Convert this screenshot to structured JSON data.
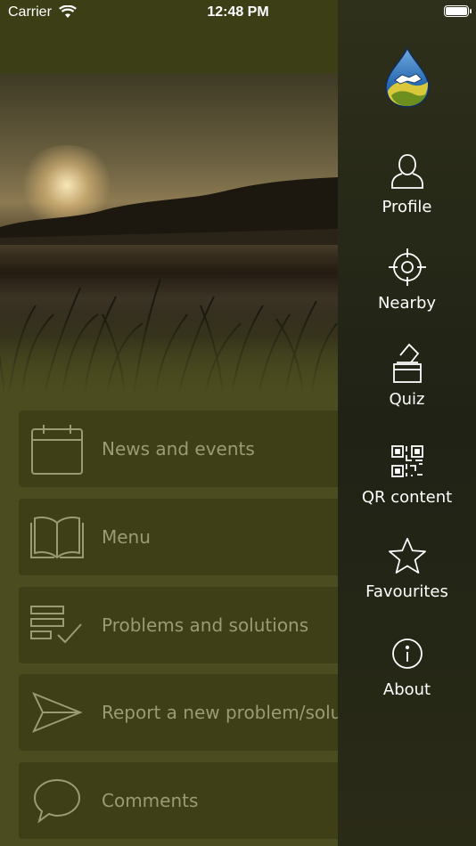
{
  "status": {
    "carrier": "Carrier",
    "time": "12:48 PM"
  },
  "main": {
    "cards": [
      {
        "label": "News and events",
        "icon": "calendar-icon"
      },
      {
        "label": "Menu",
        "icon": "open-book-icon"
      },
      {
        "label": "Problems and solutions",
        "icon": "checklist-icon"
      },
      {
        "label": "Report a new problem/solu",
        "icon": "paper-plane-icon"
      },
      {
        "label": "Comments",
        "icon": "speech-bubble-icon"
      }
    ]
  },
  "drawer": {
    "logo": "water-drop-handshake-logo",
    "items": [
      {
        "label": "Profile",
        "icon": "person-icon"
      },
      {
        "label": "Nearby",
        "icon": "crosshair-icon"
      },
      {
        "label": "Quiz",
        "icon": "ballot-box-icon"
      },
      {
        "label": "QR content",
        "icon": "qr-code-icon"
      },
      {
        "label": "Favourites",
        "icon": "star-icon"
      },
      {
        "label": "About",
        "icon": "info-icon"
      }
    ]
  },
  "colors": {
    "card_bg": "#3e3f16",
    "card_text": "#9a9b74",
    "drawer_bg": "#222416",
    "page_bg": "#4b4c1f"
  }
}
